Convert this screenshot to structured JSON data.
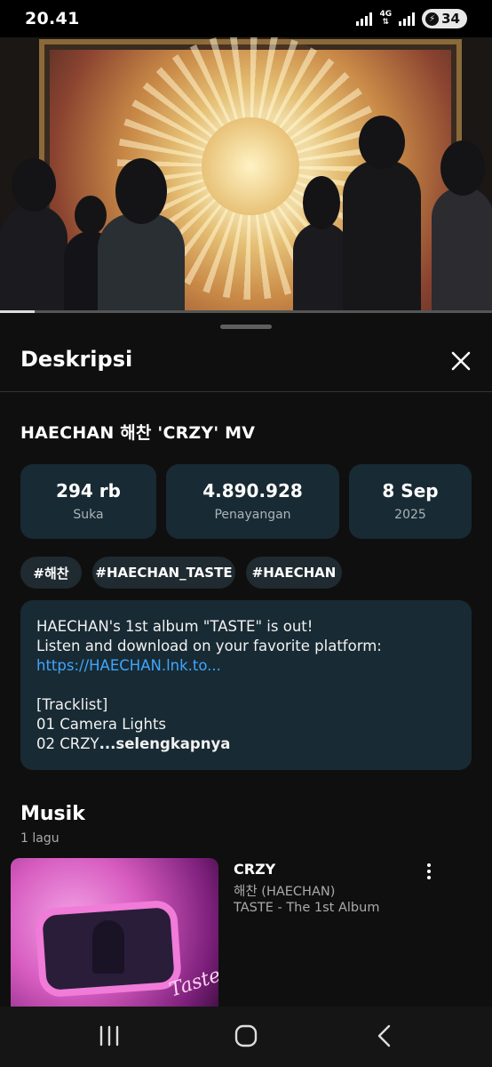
{
  "status_bar": {
    "time": "20.41",
    "network": "4G",
    "battery": "34",
    "battery_icon": "saver-bolt-icon"
  },
  "video": {
    "progress_fraction": 0.07
  },
  "sheet": {
    "title": "Deskripsi",
    "close_icon": "close-icon"
  },
  "video_info": {
    "title": "HAECHAN 해찬 'CRZY' MV",
    "stats": [
      {
        "value": "294 rb",
        "label": "Suka"
      },
      {
        "value": "4.890.928",
        "label": "Penayangan"
      },
      {
        "value": "8 Sep",
        "label": "2025"
      }
    ],
    "hashtags": [
      "#해찬",
      "#HAECHAN_TASTE",
      "#HAECHAN"
    ]
  },
  "description": {
    "line1": "HAECHAN's 1st album \"TASTE\" is out!",
    "line2": "Listen and download on your favorite platform:",
    "link": "https://HAECHAN.lnk.to...",
    "line4": "[Tracklist]",
    "line5": "01 Camera Lights",
    "line6": "02 CRZY",
    "more": "...selengkapnya"
  },
  "music": {
    "title": "Musik",
    "count": "1 lagu",
    "song": {
      "title": "CRZY",
      "artist": "해찬 (HAECHAN)",
      "album": "TASTE - The 1st Album",
      "art_text": "Taste"
    }
  },
  "nav": {
    "recents_icon": "recents-icon",
    "home_icon": "home-icon",
    "back_icon": "back-icon"
  }
}
